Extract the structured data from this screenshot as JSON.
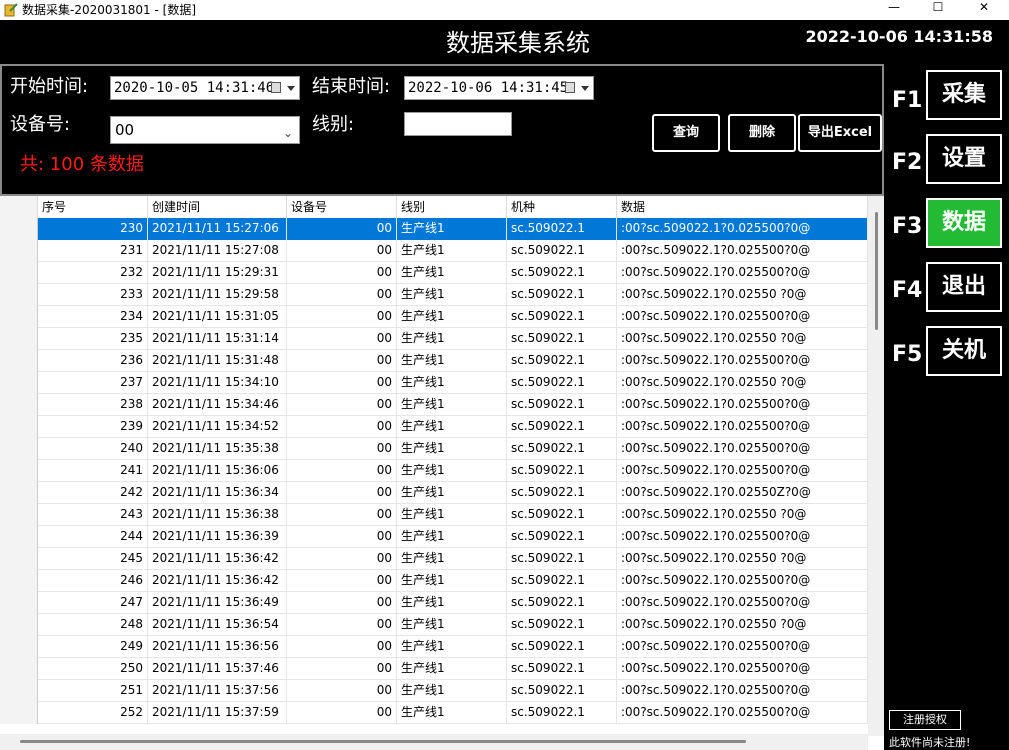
{
  "window": {
    "title": "数据采集-2020031801 - [数据]",
    "minimize_glyph": "—",
    "maximize_glyph": "☐",
    "close_glyph": "✕",
    "icon": "app-icon"
  },
  "header": {
    "app_title": "数据采集系统",
    "datetime": "2022-10-06 14:31:58"
  },
  "filter": {
    "start_label": "开始时间:",
    "start_value": "2020-10-05 14:31:46",
    "end_label": "结束时间:",
    "end_value": "2022-10-06 14:31:45",
    "device_label": "设备号:",
    "device_value": "00",
    "line_label": "线别:",
    "line_value": "",
    "count_text": "共: 100 条数据"
  },
  "actions": {
    "query": "查询",
    "delete": "删除",
    "export": "导出Excel"
  },
  "table": {
    "columns": [
      "序号",
      "创建时间",
      "设备号",
      "线别",
      "机种",
      "数据"
    ],
    "selected_index": 0,
    "rows": [
      [
        "230",
        "2021/11/11 15:27:06",
        "00",
        "生产线1",
        "sc.509022.1",
        ":00?sc.509022.1?0.025500?0@"
      ],
      [
        "231",
        "2021/11/11 15:27:08",
        "00",
        "生产线1",
        "sc.509022.1",
        ":00?sc.509022.1?0.025500?0@"
      ],
      [
        "232",
        "2021/11/11 15:29:31",
        "00",
        "生产线1",
        "sc.509022.1",
        ":00?sc.509022.1?0.025500?0@"
      ],
      [
        "233",
        "2021/11/11 15:29:58",
        "00",
        "生产线1",
        "sc.509022.1",
        ":00?sc.509022.1?0.02550 ?0@"
      ],
      [
        "234",
        "2021/11/11 15:31:05",
        "00",
        "生产线1",
        "sc.509022.1",
        ":00?sc.509022.1?0.025500?0@"
      ],
      [
        "235",
        "2021/11/11 15:31:14",
        "00",
        "生产线1",
        "sc.509022.1",
        ":00?sc.509022.1?0.02550 ?0@"
      ],
      [
        "236",
        "2021/11/11 15:31:48",
        "00",
        "生产线1",
        "sc.509022.1",
        ":00?sc.509022.1?0.025500?0@"
      ],
      [
        "237",
        "2021/11/11 15:34:10",
        "00",
        "生产线1",
        "sc.509022.1",
        ":00?sc.509022.1?0.02550 ?0@"
      ],
      [
        "238",
        "2021/11/11 15:34:46",
        "00",
        "生产线1",
        "sc.509022.1",
        ":00?sc.509022.1?0.025500?0@"
      ],
      [
        "239",
        "2021/11/11 15:34:52",
        "00",
        "生产线1",
        "sc.509022.1",
        ":00?sc.509022.1?0.025500?0@"
      ],
      [
        "240",
        "2021/11/11 15:35:38",
        "00",
        "生产线1",
        "sc.509022.1",
        ":00?sc.509022.1?0.025500?0@"
      ],
      [
        "241",
        "2021/11/11 15:36:06",
        "00",
        "生产线1",
        "sc.509022.1",
        ":00?sc.509022.1?0.025500?0@"
      ],
      [
        "242",
        "2021/11/11 15:36:34",
        "00",
        "生产线1",
        "sc.509022.1",
        ":00?sc.509022.1?0.02550Z?0@"
      ],
      [
        "243",
        "2021/11/11 15:36:38",
        "00",
        "生产线1",
        "sc.509022.1",
        ":00?sc.509022.1?0.02550 ?0@"
      ],
      [
        "244",
        "2021/11/11 15:36:39",
        "00",
        "生产线1",
        "sc.509022.1",
        ":00?sc.509022.1?0.025500?0@"
      ],
      [
        "245",
        "2021/11/11 15:36:42",
        "00",
        "生产线1",
        "sc.509022.1",
        ":00?sc.509022.1?0.02550 ?0@"
      ],
      [
        "246",
        "2021/11/11 15:36:42",
        "00",
        "生产线1",
        "sc.509022.1",
        ":00?sc.509022.1?0.025500?0@"
      ],
      [
        "247",
        "2021/11/11 15:36:49",
        "00",
        "生产线1",
        "sc.509022.1",
        ":00?sc.509022.1?0.025500?0@"
      ],
      [
        "248",
        "2021/11/11 15:36:54",
        "00",
        "生产线1",
        "sc.509022.1",
        ":00?sc.509022.1?0.02550 ?0@"
      ],
      [
        "249",
        "2021/11/11 15:36:56",
        "00",
        "生产线1",
        "sc.509022.1",
        ":00?sc.509022.1?0.025500?0@"
      ],
      [
        "250",
        "2021/11/11 15:37:46",
        "00",
        "生产线1",
        "sc.509022.1",
        ":00?sc.509022.1?0.025500?0@"
      ],
      [
        "251",
        "2021/11/11 15:37:56",
        "00",
        "生产线1",
        "sc.509022.1",
        ":00?sc.509022.1?0.025500?0@"
      ],
      [
        "252",
        "2021/11/11 15:37:59",
        "00",
        "生产线1",
        "sc.509022.1",
        ":00?sc.509022.1?0.025500?0@"
      ]
    ]
  },
  "sidebar": {
    "items": [
      {
        "key": "F1",
        "label": "采集",
        "active": false
      },
      {
        "key": "F2",
        "label": "设置",
        "active": false
      },
      {
        "key": "F3",
        "label": "数据",
        "active": true
      },
      {
        "key": "F4",
        "label": "退出",
        "active": false
      },
      {
        "key": "F5",
        "label": "关机",
        "active": false
      }
    ],
    "register_button": "注册授权",
    "register_note": "此软件尚未注册!"
  },
  "colors": {
    "background": "#000000",
    "active_nav": "#22bb33",
    "selection": "#0078d7",
    "count_text": "#ff1a1a"
  }
}
